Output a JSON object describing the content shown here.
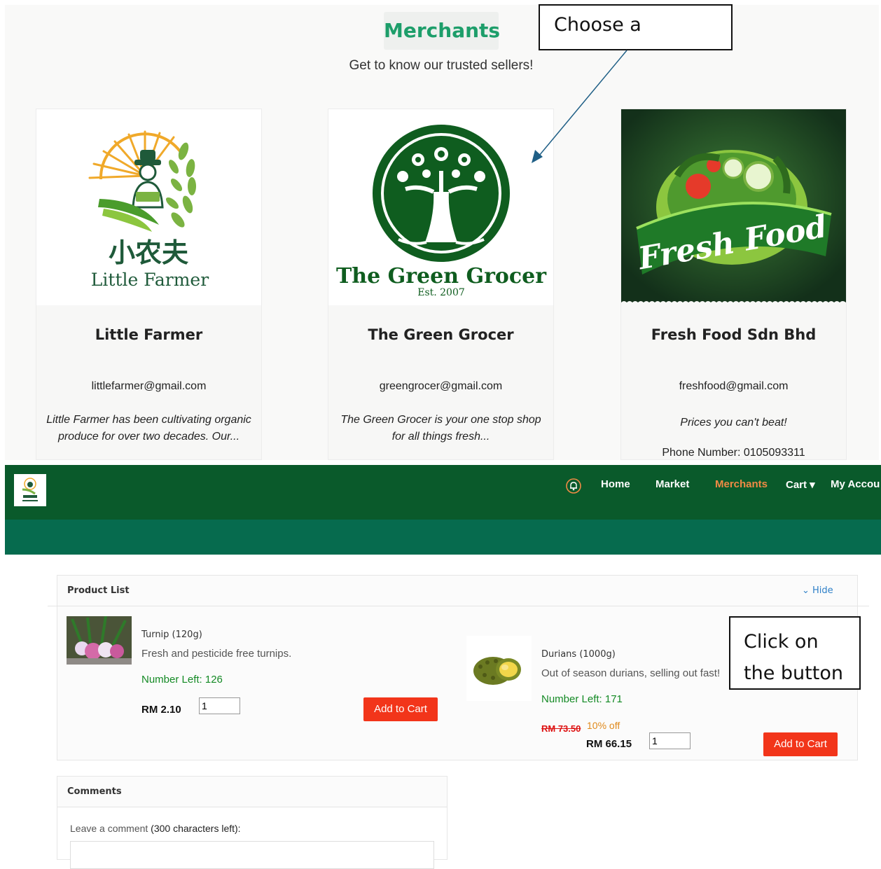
{
  "merchants_page": {
    "title": "Merchants",
    "subtitle": "Get to know our trusted sellers!",
    "cards": [
      {
        "name": "Little Farmer",
        "email": "littlefarmer@gmail.com",
        "description": "Little Farmer has been cultivating organic produce for over two decades. Our...",
        "logo_text_cn": "小农夫",
        "logo_text": "Little Farmer"
      },
      {
        "name": "The Green Grocer",
        "email": "greengrocer@gmail.com",
        "description": "The Green Grocer is your one stop shop for all things fresh...",
        "logo_text": "The Green Grocer",
        "logo_subtext": "Est. 2007"
      },
      {
        "name": "Fresh Food Sdn Bhd",
        "email": "freshfood@gmail.com",
        "description": "Prices you can't beat!",
        "phone": "Phone Number: 0105093311",
        "logo_text": "Fresh Food"
      }
    ]
  },
  "annotations": {
    "choose": "Choose a",
    "click_line1": "Click on",
    "click_line2": "the button"
  },
  "nav": {
    "items": [
      "Home",
      "Market",
      "Merchants",
      "Cart ▾",
      "My Accou"
    ],
    "active": "Merchants",
    "accent_color": "#f08a45",
    "bar_color": "#0a5a2b"
  },
  "product_list": {
    "title": "Product List",
    "hide_label": "⌄ Hide",
    "products": [
      {
        "name": "Turnip (120g)",
        "description": "Fresh and pesticide free turnips.",
        "stock": "Number Left: 126",
        "price": "RM 2.10",
        "quantity": "1",
        "button": "Add to Cart"
      },
      {
        "name": "Durians (1000g)",
        "description": "Out of season durians, selling out fast!",
        "stock": "Number Left: 171",
        "old_price": "RM 73.50",
        "discount": "10% off",
        "price": "RM 66.15",
        "quantity": "1",
        "button": "Add to Cart"
      }
    ]
  },
  "comments": {
    "title": "Comments",
    "label_prefix": "Leave a comment ",
    "label_count": "(300 characters left):"
  }
}
